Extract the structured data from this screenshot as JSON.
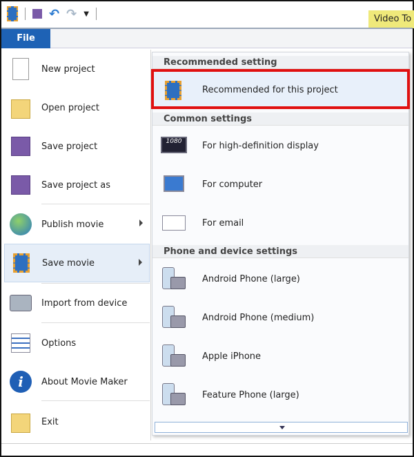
{
  "titlebar": {
    "contextual_tab": "Video To",
    "icons": [
      "movie-maker-icon",
      "save-icon",
      "undo-icon",
      "redo-icon",
      "customize-qat-icon"
    ]
  },
  "ribbon": {
    "file_tab": "File"
  },
  "file_menu": {
    "items": [
      {
        "label": "New project",
        "icon": "new-document-icon"
      },
      {
        "label": "Open project",
        "icon": "open-folder-icon"
      },
      {
        "label": "Save project",
        "icon": "save-disk-icon"
      },
      {
        "label": "Save project as",
        "icon": "save-as-icon"
      },
      {
        "label": "Publish movie",
        "icon": "globe-upload-icon",
        "submenu": true
      },
      {
        "label": "Save movie",
        "icon": "film-icon",
        "submenu": true,
        "selected": true
      },
      {
        "label": "Import from device",
        "icon": "camera-import-icon"
      },
      {
        "label": "Options",
        "icon": "options-list-icon"
      },
      {
        "label": "About Movie Maker",
        "icon": "info-icon"
      },
      {
        "label": "Exit",
        "icon": "exit-icon"
      }
    ]
  },
  "save_movie_submenu": {
    "sections": [
      {
        "header": "Recommended setting",
        "items": [
          {
            "label": "Recommended for this project",
            "icon": "recommended-icon",
            "highlighted": true
          }
        ]
      },
      {
        "header": "Common settings",
        "items": [
          {
            "label": "For high-definition display",
            "icon": "hd-display-icon",
            "badge": "1080"
          },
          {
            "label": "For computer",
            "icon": "computer-icon"
          },
          {
            "label": "For email",
            "icon": "email-icon"
          }
        ]
      },
      {
        "header": "Phone and device settings",
        "items": [
          {
            "label": "Android Phone (large)",
            "icon": "phone-icon"
          },
          {
            "label": "Android Phone (medium)",
            "icon": "phone-icon"
          },
          {
            "label": "Apple iPhone",
            "icon": "phone-icon"
          },
          {
            "label": "Feature Phone (large)",
            "icon": "phone-icon"
          }
        ]
      }
    ],
    "scroll_down": "chevron-down-icon"
  },
  "colors": {
    "file_tab": "#1e62b5",
    "highlight_box": "#e01010",
    "contextual_tab": "#efe97a"
  }
}
